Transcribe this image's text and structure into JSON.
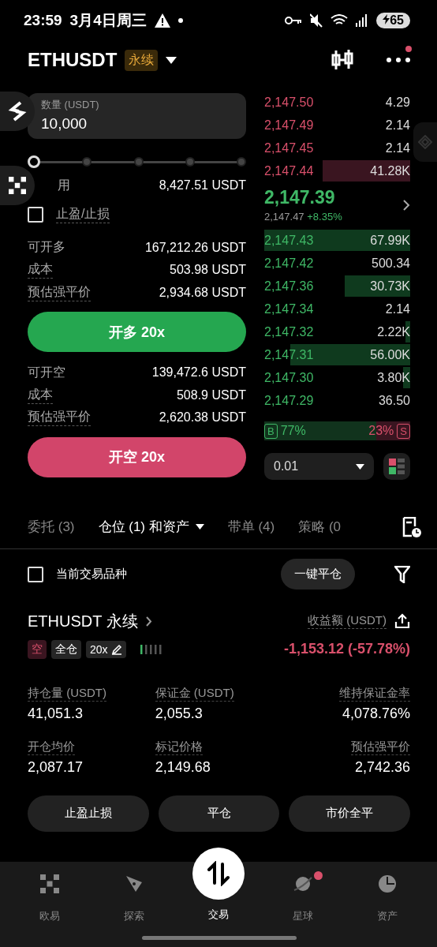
{
  "status_bar": {
    "time": "23:59",
    "date": "3月4日周三",
    "battery": "65"
  },
  "header": {
    "symbol": "ETHUSDT",
    "tag": "永续",
    "notification": true
  },
  "order_form": {
    "quantity": {
      "label": "数量 (USDT)",
      "value": "10,000"
    },
    "slider": {
      "level": 0
    },
    "available": {
      "label": "用",
      "value": "8,427.51 USDT"
    },
    "tp_sl": {
      "label": "止盈/止损",
      "checked": false
    },
    "long": {
      "rows": [
        {
          "label": "可开多",
          "value": "167,212.26 USDT"
        },
        {
          "label": "成本",
          "value": "503.98 USDT"
        },
        {
          "label": "预估强平价",
          "value": "2,934.68 USDT"
        }
      ],
      "button": "开多 20x"
    },
    "short": {
      "rows": [
        {
          "label": "可开空",
          "value": "139,472.6 USDT"
        },
        {
          "label": "成本",
          "value": "508.9 USDT"
        },
        {
          "label": "预估强平价",
          "value": "2,620.38 USDT"
        }
      ],
      "button": "开空 20x"
    }
  },
  "order_book": {
    "asks": [
      {
        "price": "2,147.50",
        "amount": "4.29"
      },
      {
        "price": "2,147.49",
        "amount": "2.14"
      },
      {
        "price": "2,147.45",
        "amount": "2.14"
      },
      {
        "price": "2,147.44",
        "amount": "41.28K",
        "level": 0.6
      }
    ],
    "last_price": "2,147.39",
    "mark_price": "2,147.47",
    "change": "+8.35%",
    "bids": [
      {
        "price": "2,147.43",
        "amount": "67.99K",
        "level": 1
      },
      {
        "price": "2,147.42",
        "amount": "500.34"
      },
      {
        "price": "2,147.36",
        "amount": "30.73K",
        "level": 0.45
      },
      {
        "price": "2,147.34",
        "amount": "2.14"
      },
      {
        "price": "2,147.32",
        "amount": "2.22K",
        "level": 0.03
      },
      {
        "price": "2,147.31",
        "amount": "56.00K",
        "level": 0.82
      },
      {
        "price": "2,147.30",
        "amount": "3.80K",
        "level": 0.05
      },
      {
        "price": "2,147.29",
        "amount": "36.50"
      }
    ],
    "ratio": {
      "buy_tag": "B",
      "buy": "77%",
      "sell": "23%",
      "sell_tag": "S"
    },
    "precision": "0.01"
  },
  "tabs": [
    {
      "label": "委托 (3)",
      "selected": false
    },
    {
      "label": "仓位 (1) 和资产",
      "selected": true
    },
    {
      "label": "带单 (4)",
      "selected": false
    },
    {
      "label": "策略 (0",
      "selected": false
    }
  ],
  "filter": {
    "label": "当前交易品种",
    "checked": false,
    "close_all": "一键平仓"
  },
  "position": {
    "title": "ETHUSDT 永续",
    "pnl_label": "收益额 (USDT)",
    "tags": [
      {
        "label": "空",
        "kind": "side"
      },
      {
        "label": "全仓",
        "kind": "plain"
      },
      {
        "label": "20x",
        "kind": "edit"
      }
    ],
    "pnl": "-1,153.12 (-57.78%)",
    "stats": [
      {
        "label": "持仓量 (USDT)",
        "value": "41,051.3"
      },
      {
        "label": "保证金 (USDT)",
        "value": "2,055.3"
      },
      {
        "label": "维持保证金率",
        "value": "4,078.76%"
      },
      {
        "label": "开仓均价",
        "value": "2,087.17"
      },
      {
        "label": "标记价格",
        "value": "2,149.68"
      },
      {
        "label": "预估强平价",
        "value": "2,742.36"
      }
    ],
    "actions": [
      "止盈止损",
      "平仓",
      "市价全平"
    ]
  },
  "nav": [
    {
      "label": "欧易",
      "selected": false,
      "badge": false
    },
    {
      "label": "探索",
      "selected": false,
      "badge": false
    },
    {
      "label": "交易",
      "selected": true,
      "badge": false
    },
    {
      "label": "星球",
      "selected": false,
      "badge": true
    },
    {
      "label": "资产",
      "selected": false,
      "badge": false
    }
  ]
}
